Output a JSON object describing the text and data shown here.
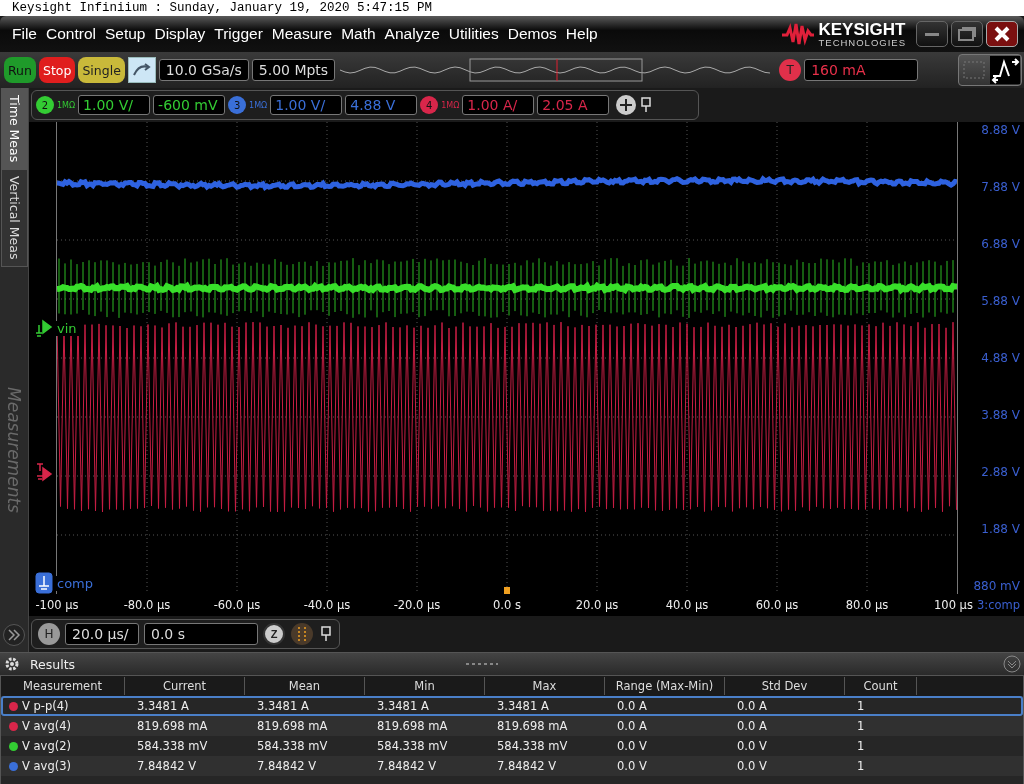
{
  "window": {
    "title": "Keysight Infiniium : Sunday, January 19, 2020 5:47:15 PM"
  },
  "menu": [
    "File",
    "Control",
    "Setup",
    "Display",
    "Trigger",
    "Measure",
    "Math",
    "Analyze",
    "Utilities",
    "Demos",
    "Help"
  ],
  "logo": {
    "name": "KEYSIGHT",
    "subtitle": "TECHNOLOGIES"
  },
  "acquisition": {
    "buttons": [
      {
        "label": "Run",
        "kind": "run"
      },
      {
        "label": "Stop",
        "kind": "stop"
      },
      {
        "label": "Single",
        "kind": "single"
      }
    ],
    "sample_rate": "10.0 GSa/s",
    "memory_depth": "5.00 Mpts",
    "trigger": {
      "label": "T",
      "value": "160 mA"
    }
  },
  "channels": [
    {
      "number": "2",
      "impedance": "1MΩ",
      "scale": "1.00 V/",
      "offset": "-600 mV",
      "color": "#33cc33"
    },
    {
      "number": "3",
      "impedance": "1MΩ",
      "scale": "1.00 V/",
      "offset": "4.88 V",
      "color": "#3a6fd8"
    },
    {
      "number": "4",
      "impedance": "1MΩ",
      "scale": "1.00 A/",
      "offset": "2.05 A",
      "color": "#d8264a"
    }
  ],
  "sidebar_tabs": [
    {
      "label": "Time Meas",
      "selected": true
    },
    {
      "label": "Vertical Meas",
      "selected": false
    }
  ],
  "panel_title": "Measurements",
  "plot": {
    "y_labels": [
      "8.88 V",
      "7.88 V",
      "6.88 V",
      "5.88 V",
      "4.88 V",
      "3.88 V",
      "2.88 V",
      "1.88 V",
      "880 mV"
    ],
    "x_labels": [
      "-100 µs",
      "-80.0 µs",
      "-60.0 µs",
      "-40.0 µs",
      "-20.0 µs",
      "0.0 s",
      "20.0 µs",
      "40.0 µs",
      "60.0 µs",
      "80.0 µs",
      "100 µs"
    ],
    "axis_source": "3:comp",
    "markers": [
      {
        "label": "vin",
        "kind": "ground",
        "color": "#33cc33"
      },
      {
        "label": "comp",
        "kind": "ground-box",
        "color": "#3a6fd8"
      },
      {
        "kind": "trigger",
        "color": "#d8264a"
      }
    ]
  },
  "timebase": {
    "label": "H",
    "scale": "20.0 µs/",
    "position": "0.0 s",
    "zoom_label": "Z"
  },
  "results": {
    "title": "Results",
    "columns": [
      "Measurement",
      "Current",
      "Mean",
      "Min",
      "Max",
      "Range (Max-Min)",
      "Std Dev",
      "Count"
    ],
    "rows": [
      {
        "color": "#d8264a",
        "selected": true,
        "cells": [
          "V p-p(4)",
          "3.3481 A",
          "3.3481 A",
          "3.3481 A",
          "3.3481 A",
          "0.0 A",
          "0.0 A",
          "1"
        ]
      },
      {
        "color": "#d8264a",
        "selected": false,
        "cells": [
          "V avg(4)",
          "819.698 mA",
          "819.698 mA",
          "819.698 mA",
          "819.698 mA",
          "0.0 A",
          "0.0 A",
          "1"
        ]
      },
      {
        "color": "#33cc33",
        "selected": false,
        "cells": [
          "V avg(2)",
          "584.338 mV",
          "584.338 mV",
          "584.338 mV",
          "584.338 mV",
          "0.0 V",
          "0.0 V",
          "1"
        ]
      },
      {
        "color": "#3a6fd8",
        "selected": false,
        "cells": [
          "V avg(3)",
          "7.84842 V",
          "7.84842 V",
          "7.84842 V",
          "7.84842 V",
          "0.0 V",
          "0.0 V",
          "1"
        ]
      }
    ]
  }
}
